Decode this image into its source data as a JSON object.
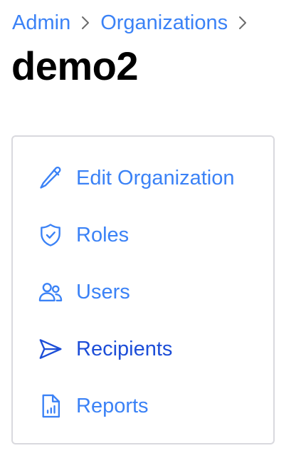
{
  "breadcrumb": {
    "items": [
      {
        "label": "Admin"
      },
      {
        "label": "Organizations"
      }
    ]
  },
  "page": {
    "title": "demo2"
  },
  "menu": {
    "items": [
      {
        "label": "Edit Organization",
        "icon": "pencil-icon"
      },
      {
        "label": "Roles",
        "icon": "shield-check-icon"
      },
      {
        "label": "Users",
        "icon": "users-icon"
      },
      {
        "label": "Recipients",
        "icon": "paper-plane-icon",
        "active": true
      },
      {
        "label": "Reports",
        "icon": "report-document-icon"
      }
    ]
  },
  "colors": {
    "link": "#3b82f6",
    "active_link": "#1d4ed8",
    "title": "#000000",
    "card_border": "#d9d9de",
    "separator": "#6b6b6b"
  }
}
